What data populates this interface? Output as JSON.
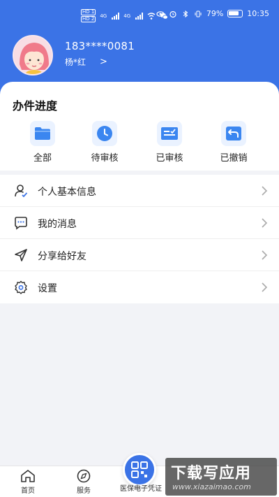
{
  "status_bar": {
    "sim1": "HD 1",
    "sim2": "HD 2",
    "net1": "4G",
    "net2": "4G",
    "battery": "79%",
    "time": "10:35"
  },
  "profile": {
    "phone": "183****0081",
    "name": "杨*红",
    "arrow": ">"
  },
  "progress": {
    "title": "办件进度",
    "items": [
      {
        "label": "全部",
        "icon": "folder-icon"
      },
      {
        "label": "待审核",
        "icon": "clock-icon"
      },
      {
        "label": "已审核",
        "icon": "approved-icon"
      },
      {
        "label": "已撤销",
        "icon": "revoke-icon"
      }
    ]
  },
  "menu": {
    "items": [
      {
        "label": "个人基本信息",
        "icon": "person-check-icon"
      },
      {
        "label": "我的消息",
        "icon": "message-icon"
      },
      {
        "label": "分享给好友",
        "icon": "send-icon"
      },
      {
        "label": "设置",
        "icon": "gear-icon"
      }
    ]
  },
  "tabbar": {
    "home": "首页",
    "service": "服务",
    "center": "医保电子凭证"
  },
  "watermark": {
    "title": "下载写应用",
    "url": "www.xiazaimao.com"
  },
  "colors": {
    "primary": "#3b73e6",
    "icon_bg": "#eaf2ff",
    "background": "#f2f3f7"
  }
}
